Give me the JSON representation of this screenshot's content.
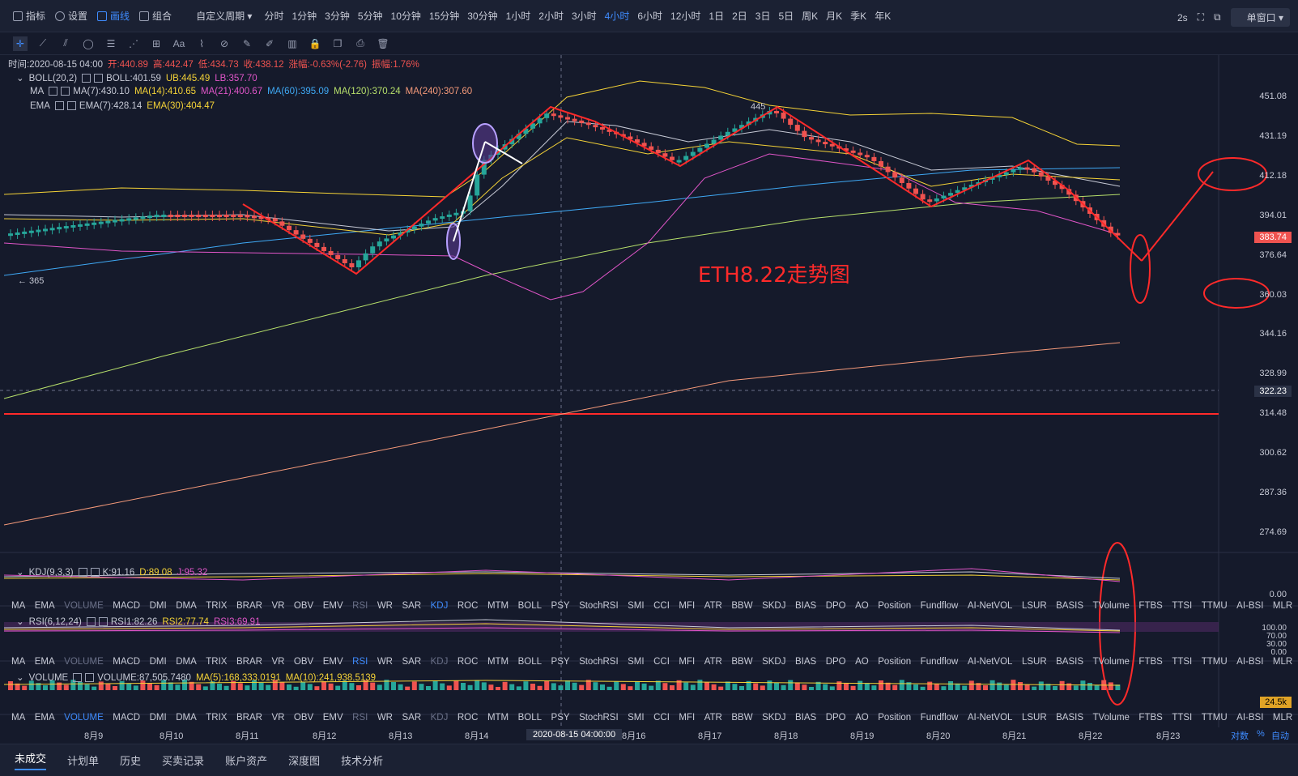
{
  "toolbar": {
    "items": [
      {
        "label": "指标"
      },
      {
        "label": "设置"
      },
      {
        "label": "画线"
      },
      {
        "label": "组合"
      }
    ],
    "period_select": "自定义周期",
    "periods": [
      "分时",
      "1分钟",
      "3分钟",
      "5分钟",
      "10分钟",
      "15分钟",
      "30分钟",
      "1小时",
      "2小时",
      "3小时",
      "4小时",
      "6小时",
      "12小时",
      "1日",
      "2日",
      "3日",
      "5日",
      "周K",
      "月K",
      "季K",
      "年K"
    ],
    "active_period": "4小时",
    "speed": "2s",
    "window_mode": "单窗口"
  },
  "draw_tools": [
    "cross-icon",
    "line-icon",
    "channel-icon",
    "ellipse-icon",
    "fib-icon",
    "wave-icon",
    "grid-icon",
    "text-icon",
    "pattern-icon",
    "measure-icon",
    "brush-icon",
    "pen-icon",
    "ruler-icon",
    "lock-icon",
    "copy-icon",
    "screenshot-icon",
    "trash-icon"
  ],
  "legend": {
    "info": {
      "time": "时间:2020-08-15 04:00",
      "open": "开:440.89",
      "high": "高:442.47",
      "low": "低:434.73",
      "close": "收:438.12",
      "change": "涨幅:-0.63%(-2.76)",
      "amp": "振幅:1.76%"
    },
    "boll": {
      "name": "BOLL(20,2)",
      "boll": "BOLL:401.59",
      "ub": "UB:445.49",
      "lb": "LB:357.70"
    },
    "ma": {
      "name": "MA",
      "ma7": "MA(7):430.10",
      "ma14": "MA(14):410.65",
      "ma21": "MA(21):400.67",
      "ma60": "MA(60):395.09",
      "ma120": "MA(120):370.24",
      "ma240": "MA(240):307.60"
    },
    "ema": {
      "name": "EMA",
      "ema7": "EMA(7):428.14",
      "ema30": "EMA(30):404.47"
    },
    "kdj": {
      "name": "KDJ(9,3,3)",
      "k": "K:91.16",
      "d": "D:89.08",
      "j": "J:95.32"
    },
    "rsi": {
      "name": "RSI(6,12,24)",
      "r1": "RSI1:82.26",
      "r2": "RSI2:77.74",
      "r3": "RSI3:69.91"
    },
    "vol": {
      "name": "VOLUME",
      "v": "VOLUME:87,505.7480",
      "ma5": "MA(5):168,333.0191",
      "ma10": "MA(10):241,938.5139"
    }
  },
  "indicator_tabs": [
    "MA",
    "EMA",
    "VOLUME",
    "MACD",
    "DMI",
    "DMA",
    "TRIX",
    "BRAR",
    "VR",
    "OBV",
    "EMV",
    "RSI",
    "WR",
    "SAR",
    "KDJ",
    "ROC",
    "MTM",
    "BOLL",
    "PSY",
    "StochRSI",
    "SMI",
    "CCI",
    "MFI",
    "ATR",
    "BBW",
    "SKDJ",
    "BIAS",
    "DPO",
    "AO",
    "Position",
    "Fundflow",
    "AI-NetVOL",
    "LSUR",
    "BASIS",
    "TVolume",
    "FTBS",
    "TTSI",
    "TTMU",
    "AI-BSI",
    "MLR"
  ],
  "price_axis": [
    "451.08",
    "431.19",
    "412.18",
    "394.01",
    "376.64",
    "360.03",
    "344.16",
    "328.99",
    "314.48",
    "300.62",
    "287.36",
    "274.69"
  ],
  "current_price": "383.74",
  "crosshair_price": "322.23",
  "kdj_axis": "0.00",
  "rsi_axis": [
    "100.00",
    "70.00",
    "30.00",
    "0.00"
  ],
  "vol_current": "24.5k",
  "x_axis": [
    "8月9",
    "8月10",
    "8月11",
    "8月12",
    "8月13",
    "8月14",
    "2020-08-15 04:00:00",
    "8月16",
    "8月17",
    "8月18",
    "8月19",
    "8月20",
    "8月21",
    "8月22",
    "8月23"
  ],
  "axis_mode": [
    "对数",
    "%",
    "自动"
  ],
  "annotation": {
    "title": "ETH8.22走势图",
    "peak": "445",
    "low": "← 365"
  },
  "bottom_tabs": [
    "未成交",
    "计划单",
    "历史",
    "买卖记录",
    "账户资产",
    "深度图",
    "技术分析"
  ],
  "colors": {
    "up": "#26a69a",
    "down": "#ef5350",
    "accent": "#3f8cff",
    "annot": "#ff2a2a"
  }
}
